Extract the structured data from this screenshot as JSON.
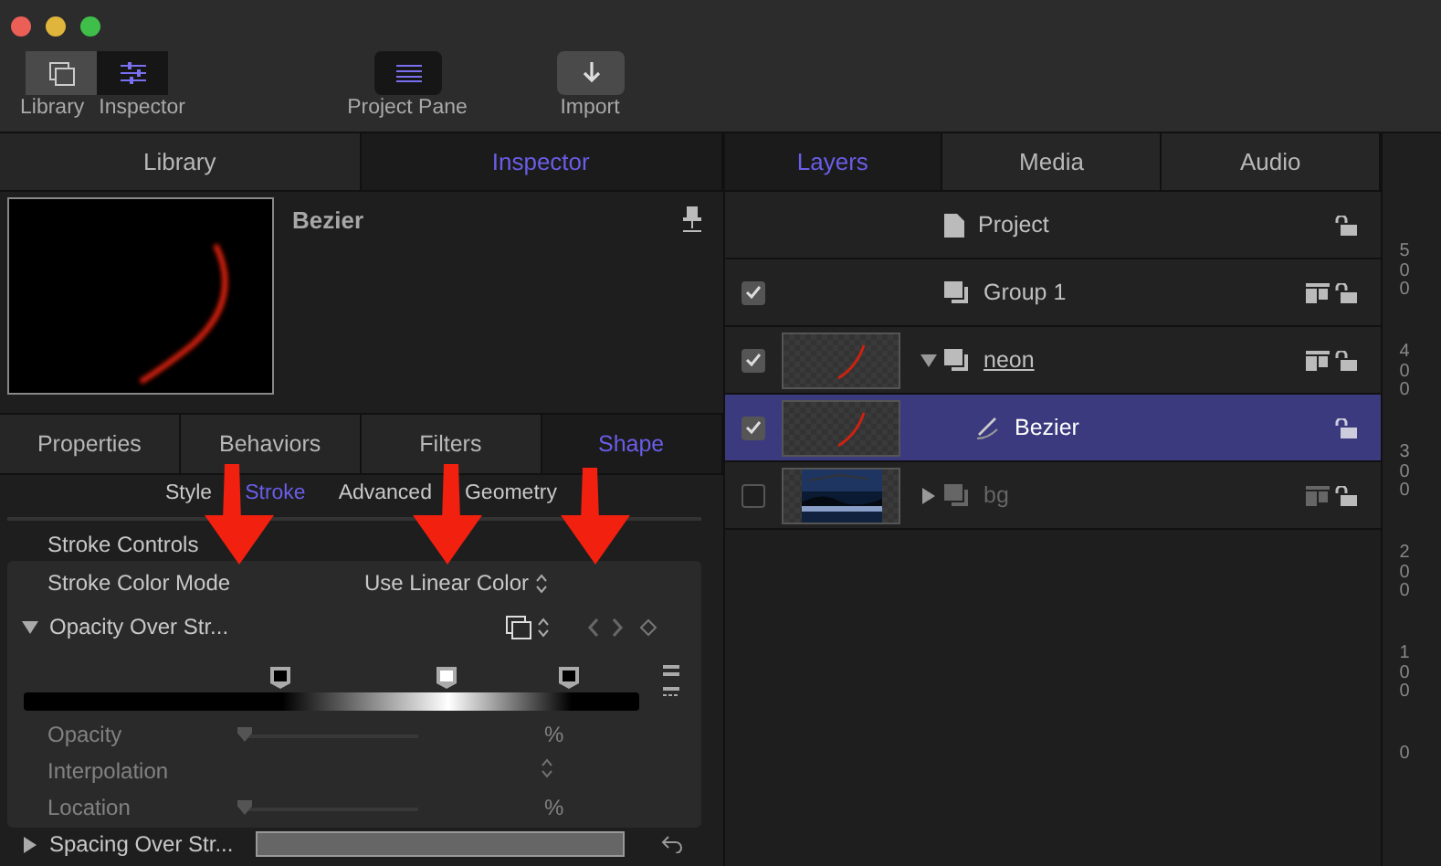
{
  "toolbar": {
    "segments": [
      {
        "label": "Library",
        "selected": false
      },
      {
        "label": "Inspector",
        "selected": true
      }
    ],
    "buttons": [
      {
        "label": "Project Pane",
        "kind": "pane",
        "selected": true
      },
      {
        "label": "Import",
        "kind": "import",
        "selected": false
      }
    ]
  },
  "left_tabs": [
    {
      "label": "Library",
      "selected": false
    },
    {
      "label": "Inspector",
      "selected": true
    }
  ],
  "inspector": {
    "title": "Bezier",
    "tabs": [
      {
        "label": "Properties",
        "selected": false
      },
      {
        "label": "Behaviors",
        "selected": false
      },
      {
        "label": "Filters",
        "selected": false
      },
      {
        "label": "Shape",
        "selected": true
      }
    ],
    "subtabs": [
      {
        "label": "Style",
        "selected": false
      },
      {
        "label": "Stroke",
        "selected": true
      },
      {
        "label": "Advanced",
        "selected": false
      },
      {
        "label": "Geometry",
        "selected": false
      }
    ],
    "section": "Stroke Controls",
    "color_mode": {
      "label": "Stroke Color Mode",
      "value": "Use Linear Color"
    },
    "opacity_over_stroke": {
      "label": "Opacity Over Str...",
      "expanded": true,
      "stops": [
        {
          "level": 0.42,
          "color": "#000000"
        },
        {
          "level": 0.69,
          "color": "#ffffff"
        },
        {
          "level": 0.89,
          "color": "#000000"
        }
      ],
      "rows": [
        {
          "label": "Opacity",
          "kind": "slider",
          "level": 0,
          "unit": "%",
          "disabled": true
        },
        {
          "label": "Interpolation",
          "kind": "popup",
          "disabled": true
        },
        {
          "label": "Location",
          "kind": "slider",
          "level": 0,
          "unit": "%",
          "disabled": true
        }
      ]
    },
    "spacing": {
      "label": "Spacing Over Str...",
      "expanded": false
    }
  },
  "right_tabs": [
    {
      "label": "Layers",
      "selected": true
    },
    {
      "label": "Media",
      "selected": false
    },
    {
      "label": "Audio",
      "selected": false
    }
  ],
  "layers": [
    {
      "name": "Project",
      "kind": "project",
      "selected": false
    },
    {
      "name": "Group 1",
      "kind": "group",
      "checked": true,
      "selected": false,
      "children": [
        {
          "name": "neon",
          "kind": "group",
          "checked": true,
          "selected": false,
          "expanded": true,
          "underlined": true,
          "thumbnail": {
            "kind": "stroke"
          },
          "children": [
            {
              "name": "Bezier",
              "kind": "shape",
              "checked": true,
              "selected": true,
              "thumbnail": {
                "kind": "stroke"
              }
            }
          ]
        },
        {
          "name": "bg",
          "kind": "group",
          "checked": false,
          "selected": false,
          "expanded": false
        }
      ]
    }
  ],
  "ruler": [
    "500",
    "400",
    "300",
    "200",
    "100",
    "0"
  ]
}
